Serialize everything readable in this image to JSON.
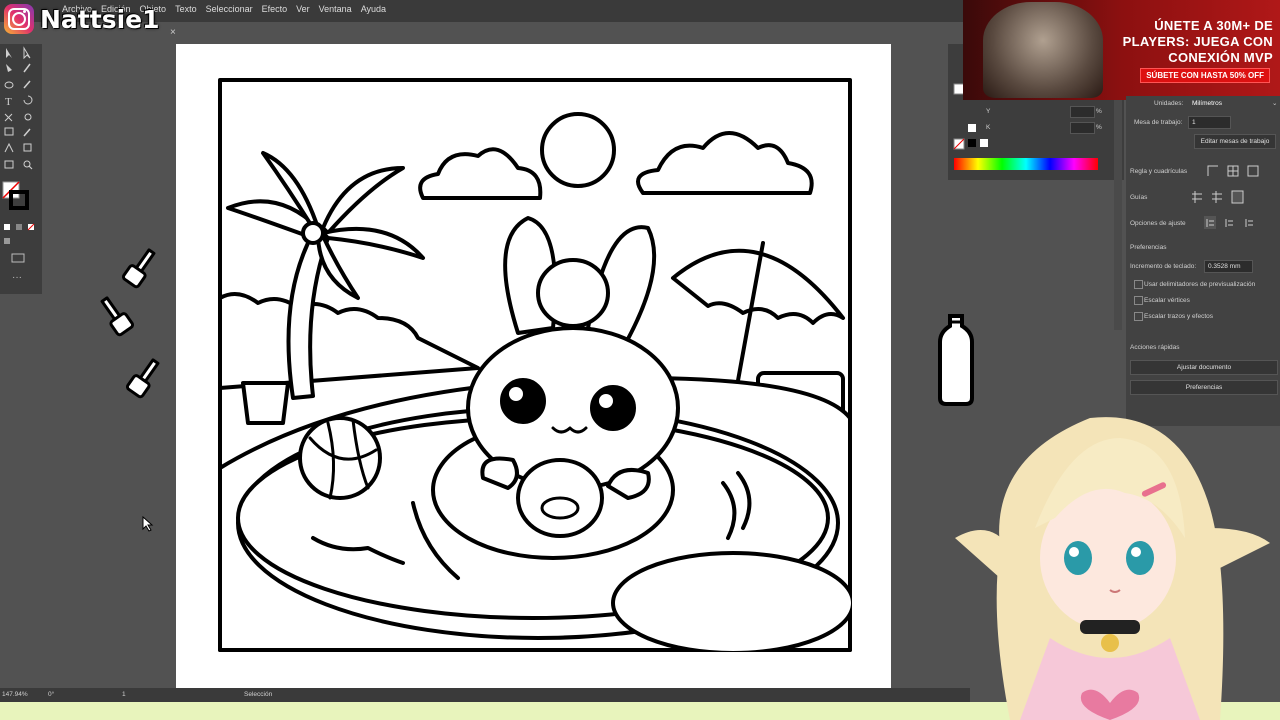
{
  "brand": {
    "name": "Nattsie1"
  },
  "menu": {
    "items": [
      "Archivo",
      "Edición",
      "Objeto",
      "Texto",
      "Seleccionar",
      "Efecto",
      "Ver",
      "Ventana",
      "Ayuda"
    ]
  },
  "document_tab": {
    "close": "×"
  },
  "ad": {
    "headline": "ÚNETE A 30M+ DE PLAYERS: JUEGA CON CONEXIÓN MVP",
    "cta": "SÚBETE CON HASTA 50% OFF"
  },
  "properties_panel": {
    "units_label": "Unidades:",
    "units_value": "Milímetros",
    "artboard_label": "Mesa de trabajo:",
    "artboard_value": "1",
    "edit_artboards": "Editar mesas de trabajo",
    "rulers_grids": "Regla y cuadrículas",
    "guides": "Guías",
    "snap_options": "Opciones de ajuste",
    "preferences_heading": "Preferencias",
    "keyboard_increment_label": "Incremento de teclado:",
    "keyboard_increment_value": "0.3528 mm",
    "checkboxes": [
      "Usar delimitadores de previsualización",
      "Escalar vértices",
      "Escalar trazos y efectos"
    ],
    "quick_actions": "Acciones rápidas",
    "fit_document": "Ajustar documento",
    "preferences_button": "Preferencias"
  },
  "color_panel": {
    "y_label": "Y",
    "k_label": "K",
    "pct": "%"
  },
  "statusbar": {
    "zoom": "147.94%",
    "rotation": "0°",
    "artboard": "1",
    "tool": "Selección"
  },
  "colors": {
    "ui_dark": "#3a3a3a",
    "canvas_bg": "#525252",
    "accent_green": "#e8f4bc"
  }
}
